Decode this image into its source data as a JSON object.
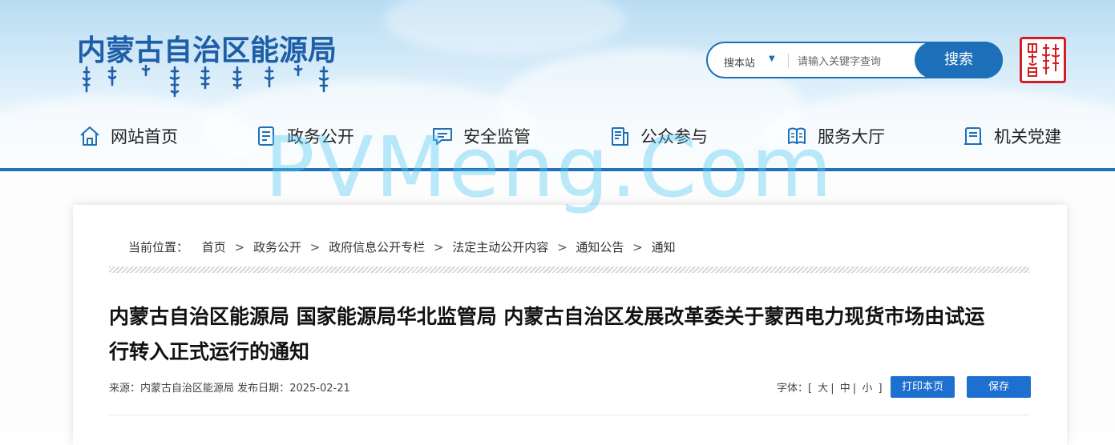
{
  "site": {
    "title": "内蒙古自治区能源局",
    "seal_text": "内蒙古"
  },
  "search": {
    "scope": "搜本站",
    "placeholder": "请输入关键字查询",
    "button": "搜索"
  },
  "nav": [
    {
      "label": "网站首页",
      "icon": "home-icon"
    },
    {
      "label": "政务公开",
      "icon": "document-list-icon"
    },
    {
      "label": "安全监管",
      "icon": "message-icon"
    },
    {
      "label": "公众参与",
      "icon": "clipboard-icon"
    },
    {
      "label": "服务大厅",
      "icon": "book-icon"
    },
    {
      "label": "机关党建",
      "icon": "badge-icon"
    }
  ],
  "watermark": "PVMeng.Com",
  "breadcrumb": {
    "label": "当前位置：",
    "separator": ">",
    "items": [
      "首页",
      "政务公开",
      "政府信息公开专栏",
      "法定主动公开内容",
      "通知公告",
      "通知"
    ]
  },
  "article": {
    "title": "内蒙古自治区能源局 国家能源局华北监管局 内蒙古自治区发展改革委关于蒙西电力现货市场由试运行转入正式运行的通知",
    "source_label": "来源：",
    "source": "内蒙古自治区能源局",
    "date_label": "发布日期：",
    "date": "2025-02-21"
  },
  "toolbar": {
    "font_label": "字体：",
    "open_bracket": "[",
    "close_bracket": "]",
    "sizes": [
      "大",
      "中",
      "小"
    ],
    "size_separator": "|",
    "print": "打印本页",
    "save": "保存"
  },
  "colors": {
    "brand_blue": "#1e5ea8",
    "header_line": "#2372b8",
    "button_blue": "#1d6fd0",
    "seal_red": "#d21f24",
    "watermark": "#55ccf2"
  }
}
